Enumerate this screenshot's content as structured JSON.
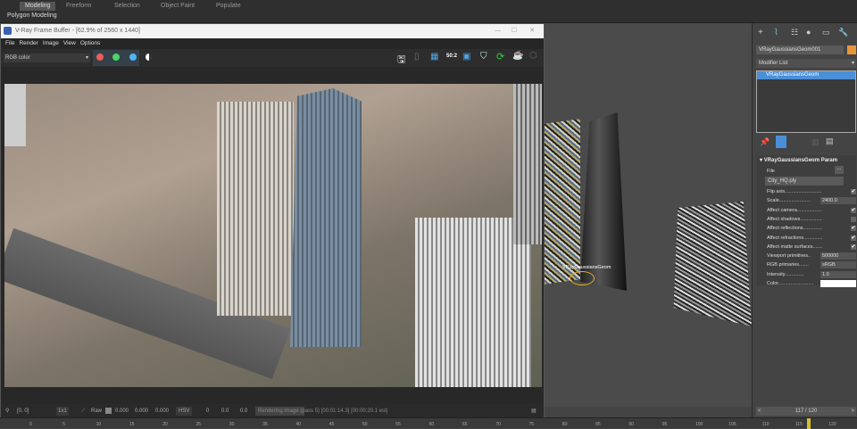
{
  "ribbon": {
    "tabs": [
      "Modeling",
      "Freeform",
      "Selection",
      "Object Paint",
      "Populate"
    ],
    "active": "Modeling",
    "subtitle": "Polygon Modeling"
  },
  "vfb": {
    "title": "V-Ray Frame Buffer - [62.9% of 2560 x 1440]",
    "menu": [
      "File",
      "Render",
      "Image",
      "View",
      "Options"
    ],
    "channel": "RGB color",
    "status": {
      "coords": "[0, 0]",
      "zoom": "1x1",
      "mode": "Raw",
      "r": "0.000",
      "g": "0.000",
      "b": "0.000",
      "colorspace": "HSV",
      "h": "0",
      "s": "0.0",
      "v": "0.0",
      "message": "Rendering image (pass 5) [00:01:14.3] [00:00:20.1 est]"
    }
  },
  "viewport": {
    "object_label": "VRayGaussiansGeom"
  },
  "command_panel": {
    "object_name": "VRayGaussiansGeom001",
    "object_color": "#e8963c",
    "modifier_list": "Modifier List",
    "stack": [
      "VRayGaussiansGeom"
    ],
    "rollout_title": "VRayGaussiansGeom Param",
    "file_label": "File",
    "file_button": "...",
    "file_value": "City_HQ.ply",
    "params": [
      {
        "label": "Flip axis...........................",
        "checked": true
      },
      {
        "label": "Scale.......................",
        "value": "2400.0"
      },
      {
        "label": "Affect camera...................",
        "checked": true
      },
      {
        "label": "Affect shadows..................",
        "checked": false
      },
      {
        "label": "Affect reflections..............",
        "checked": true
      },
      {
        "label": "Affect refractions..............",
        "checked": true
      },
      {
        "label": "Affect matte surfaces...........",
        "checked": true
      },
      {
        "label": "Viewport primitives..",
        "value": "500000"
      },
      {
        "label": "RGB primaries.......",
        "value": "sRGB"
      },
      {
        "label": "Intensity..............",
        "value": "1.0"
      },
      {
        "label": "Color..........................",
        "color": "#ffffff"
      }
    ]
  },
  "timeline": {
    "frame": "117 / 120",
    "current": 117,
    "ticks": [
      "0",
      "5",
      "10",
      "15",
      "20",
      "25",
      "30",
      "35",
      "40",
      "45",
      "50",
      "55",
      "60",
      "65",
      "70",
      "75",
      "80",
      "85",
      "90",
      "95",
      "100",
      "105",
      "110",
      "115",
      "120"
    ]
  }
}
